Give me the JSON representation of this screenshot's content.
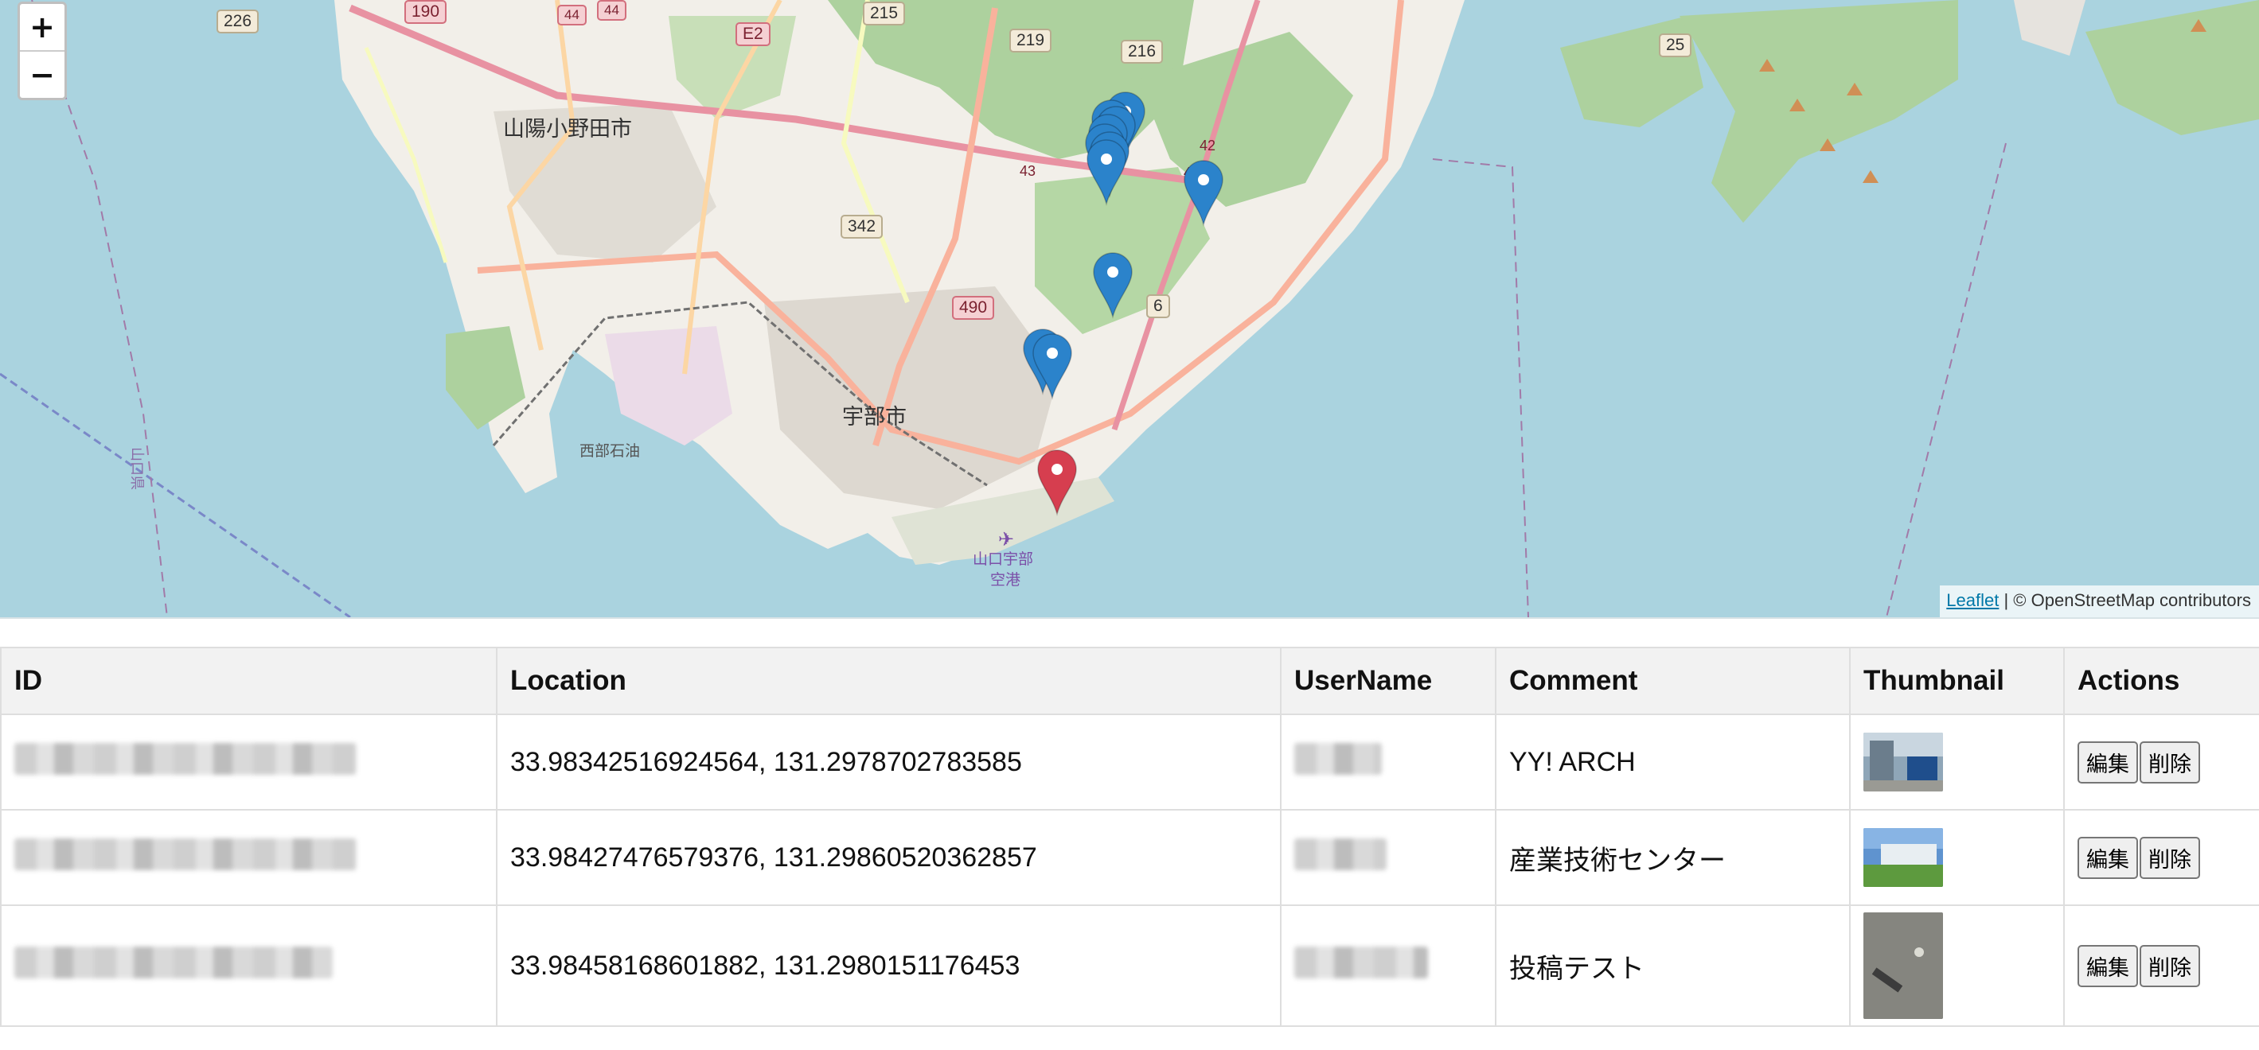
{
  "map": {
    "zoom_in_label": "+",
    "zoom_out_label": "−",
    "attribution": {
      "leaflet": "Leaflet",
      "rest": " | © OpenStreetMap contributors"
    },
    "place_labels": [
      "山陽小野田市",
      "宇部市",
      "西部石油",
      "山口宇部",
      "空港",
      "山口県"
    ],
    "road_shields": [
      "226",
      "190",
      "44",
      "44",
      "E2",
      "215",
      "219",
      "216",
      "25",
      "43",
      "42",
      "42",
      "342",
      "490",
      "6"
    ],
    "markers": {
      "blue_count": 11,
      "red_count": 1,
      "blue": "#2b83cb",
      "red": "#d63e4f"
    }
  },
  "table": {
    "headers": [
      "ID",
      "Location",
      "UserName",
      "Comment",
      "Thumbnail",
      "Actions"
    ],
    "rows": [
      {
        "location": "33.98342516924564, 131.2978702783585",
        "comment": "YY! ARCH",
        "edit": "編集",
        "delete": "削除"
      },
      {
        "location": "33.98427476579376, 131.29860520362857",
        "comment": "産業技術センター",
        "edit": "編集",
        "delete": "削除"
      },
      {
        "location": "33.98458168601882, 131.2980151176453",
        "comment": "投稿テスト",
        "edit": "編集",
        "delete": "削除"
      }
    ]
  }
}
